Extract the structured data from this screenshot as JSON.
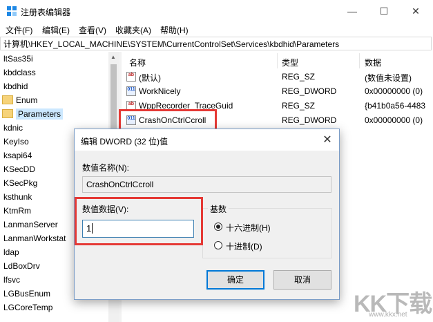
{
  "window": {
    "title": "注册表编辑器",
    "minimize": "—",
    "maximize": "☐",
    "close": "✕"
  },
  "menu": [
    "文件(F)",
    "编辑(E)",
    "查看(V)",
    "收藏夹(A)",
    "帮助(H)"
  ],
  "address": "计算机\\HKEY_LOCAL_MACHINE\\SYSTEM\\CurrentControlSet\\Services\\kbdhid\\Parameters",
  "tree": [
    {
      "label": "ltSas35i",
      "folder": false,
      "selected": false
    },
    {
      "label": "kbdclass",
      "folder": false,
      "selected": false
    },
    {
      "label": "kbdhid",
      "folder": false,
      "selected": false
    },
    {
      "label": "Enum",
      "folder": true,
      "selected": false
    },
    {
      "label": "Parameters",
      "folder": true,
      "selected": true
    },
    {
      "label": "kdnic",
      "folder": false,
      "selected": false
    },
    {
      "label": "KeyIso",
      "folder": false,
      "selected": false
    },
    {
      "label": "ksapi64",
      "folder": false,
      "selected": false
    },
    {
      "label": "KSecDD",
      "folder": false,
      "selected": false
    },
    {
      "label": "KSecPkg",
      "folder": false,
      "selected": false
    },
    {
      "label": "ksthunk",
      "folder": false,
      "selected": false
    },
    {
      "label": "KtmRm",
      "folder": false,
      "selected": false
    },
    {
      "label": "LanmanServer",
      "folder": false,
      "selected": false
    },
    {
      "label": "LanmanWorkstat",
      "folder": false,
      "selected": false
    },
    {
      "label": "ldap",
      "folder": false,
      "selected": false
    },
    {
      "label": "LdBoxDrv",
      "folder": false,
      "selected": false
    },
    {
      "label": "lfsvc",
      "folder": false,
      "selected": false
    },
    {
      "label": "LGBusEnum",
      "folder": false,
      "selected": false
    },
    {
      "label": "LGCoreTemp",
      "folder": false,
      "selected": false
    }
  ],
  "list": {
    "columns": [
      "名称",
      "类型",
      "数据"
    ],
    "rows": [
      {
        "icon": "string-value-icon",
        "name": "(默认)",
        "type": "REG_SZ",
        "data": "(数值未设置)"
      },
      {
        "icon": "binary-value-icon",
        "name": "WorkNicely",
        "type": "REG_DWORD",
        "data": "0x00000000 (0)"
      },
      {
        "icon": "string-value-icon",
        "name": "WppRecorder_TraceGuid",
        "type": "REG_SZ",
        "data": "{b41b0a56-4483"
      },
      {
        "icon": "binary-value-icon",
        "name": "CrashOnCtrlCcroll",
        "type": "REG_DWORD",
        "data": "0x00000000 (0)"
      }
    ]
  },
  "dialog": {
    "title": "编辑 DWORD (32 位)值",
    "close": "✕",
    "name_label": "数值名称(N):",
    "name_value": "CrashOnCtrlCcroll",
    "data_label": "数值数据(V):",
    "data_value": "1",
    "base_label": "基数",
    "hex_label": "十六进制(H)",
    "dec_label": "十进制(D)",
    "hex_selected": true,
    "ok_label": "确定",
    "cancel_label": "取消"
  },
  "watermark": {
    "text": "KK下载",
    "url": "www.kkx.net"
  },
  "colors": {
    "highlight": "#e53935",
    "accent": "#0078d7",
    "selection": "#cce8ff"
  }
}
